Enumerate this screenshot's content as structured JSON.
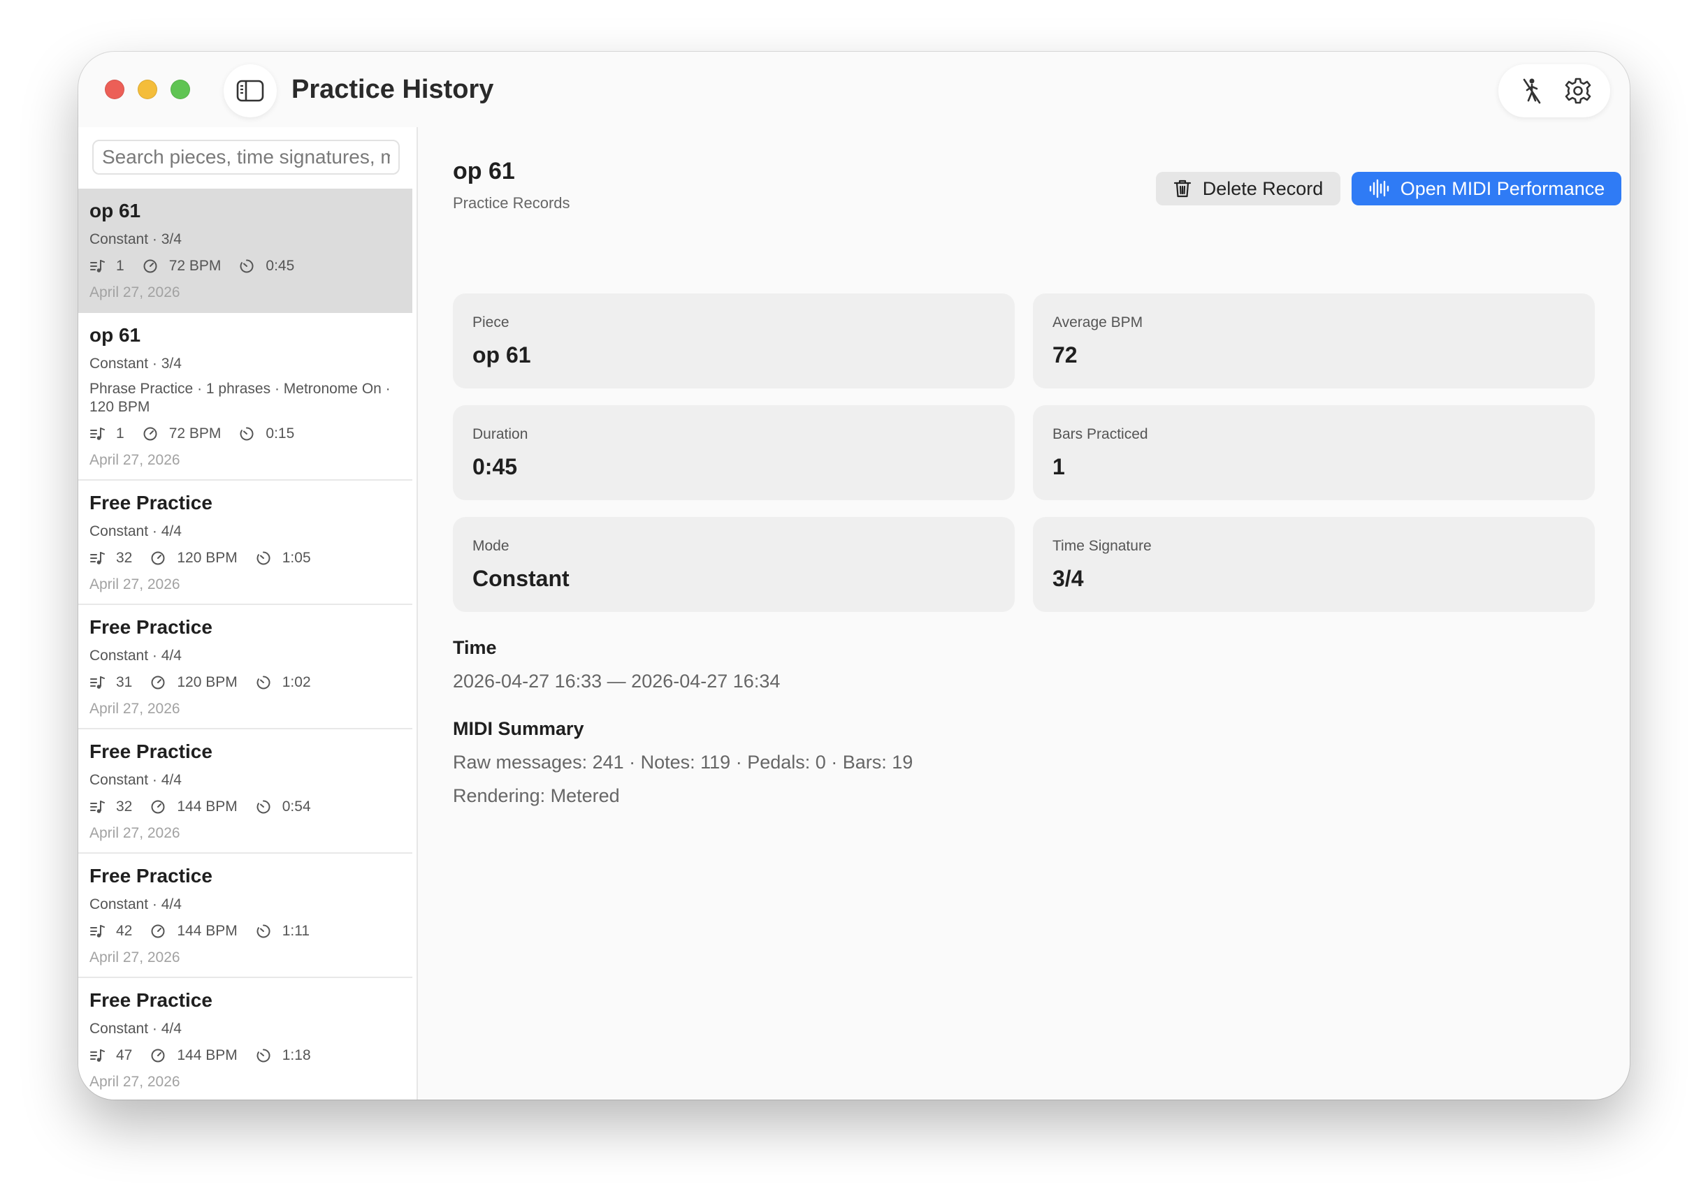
{
  "window": {
    "title": "Practice History"
  },
  "toolbar": {
    "sidebar_toggle_icon": "sidebar-icon",
    "metronome_icon": "metronome-off-icon",
    "settings_icon": "gear-icon"
  },
  "sidebar": {
    "search_placeholder": "Search pieces, time signatures, mo",
    "items": [
      {
        "title": "op 61",
        "sub": "Constant · 3/4",
        "extra": "",
        "bars": "1",
        "bpm": "72 BPM",
        "duration": "0:45",
        "date": "April 27, 2026",
        "selected": true
      },
      {
        "title": "op 61",
        "sub": "Constant · 3/4",
        "extra": "Phrase Practice · 1 phrases · Metronome On · 120 BPM",
        "bars": "1",
        "bpm": "72 BPM",
        "duration": "0:15",
        "date": "April 27, 2026"
      },
      {
        "title": "Free Practice",
        "sub": "Constant · 4/4",
        "extra": "",
        "bars": "32",
        "bpm": "120 BPM",
        "duration": "1:05",
        "date": "April 27, 2026"
      },
      {
        "title": "Free Practice",
        "sub": "Constant · 4/4",
        "extra": "",
        "bars": "31",
        "bpm": "120 BPM",
        "duration": "1:02",
        "date": "April 27, 2026"
      },
      {
        "title": "Free Practice",
        "sub": "Constant · 4/4",
        "extra": "",
        "bars": "32",
        "bpm": "144 BPM",
        "duration": "0:54",
        "date": "April 27, 2026"
      },
      {
        "title": "Free Practice",
        "sub": "Constant · 4/4",
        "extra": "",
        "bars": "42",
        "bpm": "144 BPM",
        "duration": "1:11",
        "date": "April 27, 2026"
      },
      {
        "title": "Free Practice",
        "sub": "Constant · 4/4",
        "extra": "",
        "bars": "47",
        "bpm": "144 BPM",
        "duration": "1:18",
        "date": "April 27, 2026"
      }
    ]
  },
  "detail": {
    "title": "op 61",
    "subtitle": "Practice Records",
    "delete_label": "Delete Record",
    "open_label": "Open MIDI Performance",
    "cards": {
      "piece": {
        "label": "Piece",
        "value": "op 61"
      },
      "avg_bpm": {
        "label": "Average BPM",
        "value": "72"
      },
      "duration": {
        "label": "Duration",
        "value": "0:45"
      },
      "bars": {
        "label": "Bars Practiced",
        "value": "1"
      },
      "mode": {
        "label": "Mode",
        "value": "Constant"
      },
      "time_sig": {
        "label": "Time Signature",
        "value": "3/4"
      }
    },
    "time_heading": "Time",
    "time_value": "2026-04-27 16:33 — 2026-04-27 16:34",
    "midi_heading": "MIDI Summary",
    "midi_line1": "Raw messages: 241 · Notes: 119 · Pedals: 0 · Bars: 19",
    "midi_line2": "Rendering: Metered"
  },
  "colors": {
    "accent": "#2f7bf5",
    "selected_row": "#dcdcdc",
    "card_bg": "#efefef",
    "close": "#ec5f57",
    "minimize": "#f4bd3a",
    "maximize": "#5fc453"
  }
}
